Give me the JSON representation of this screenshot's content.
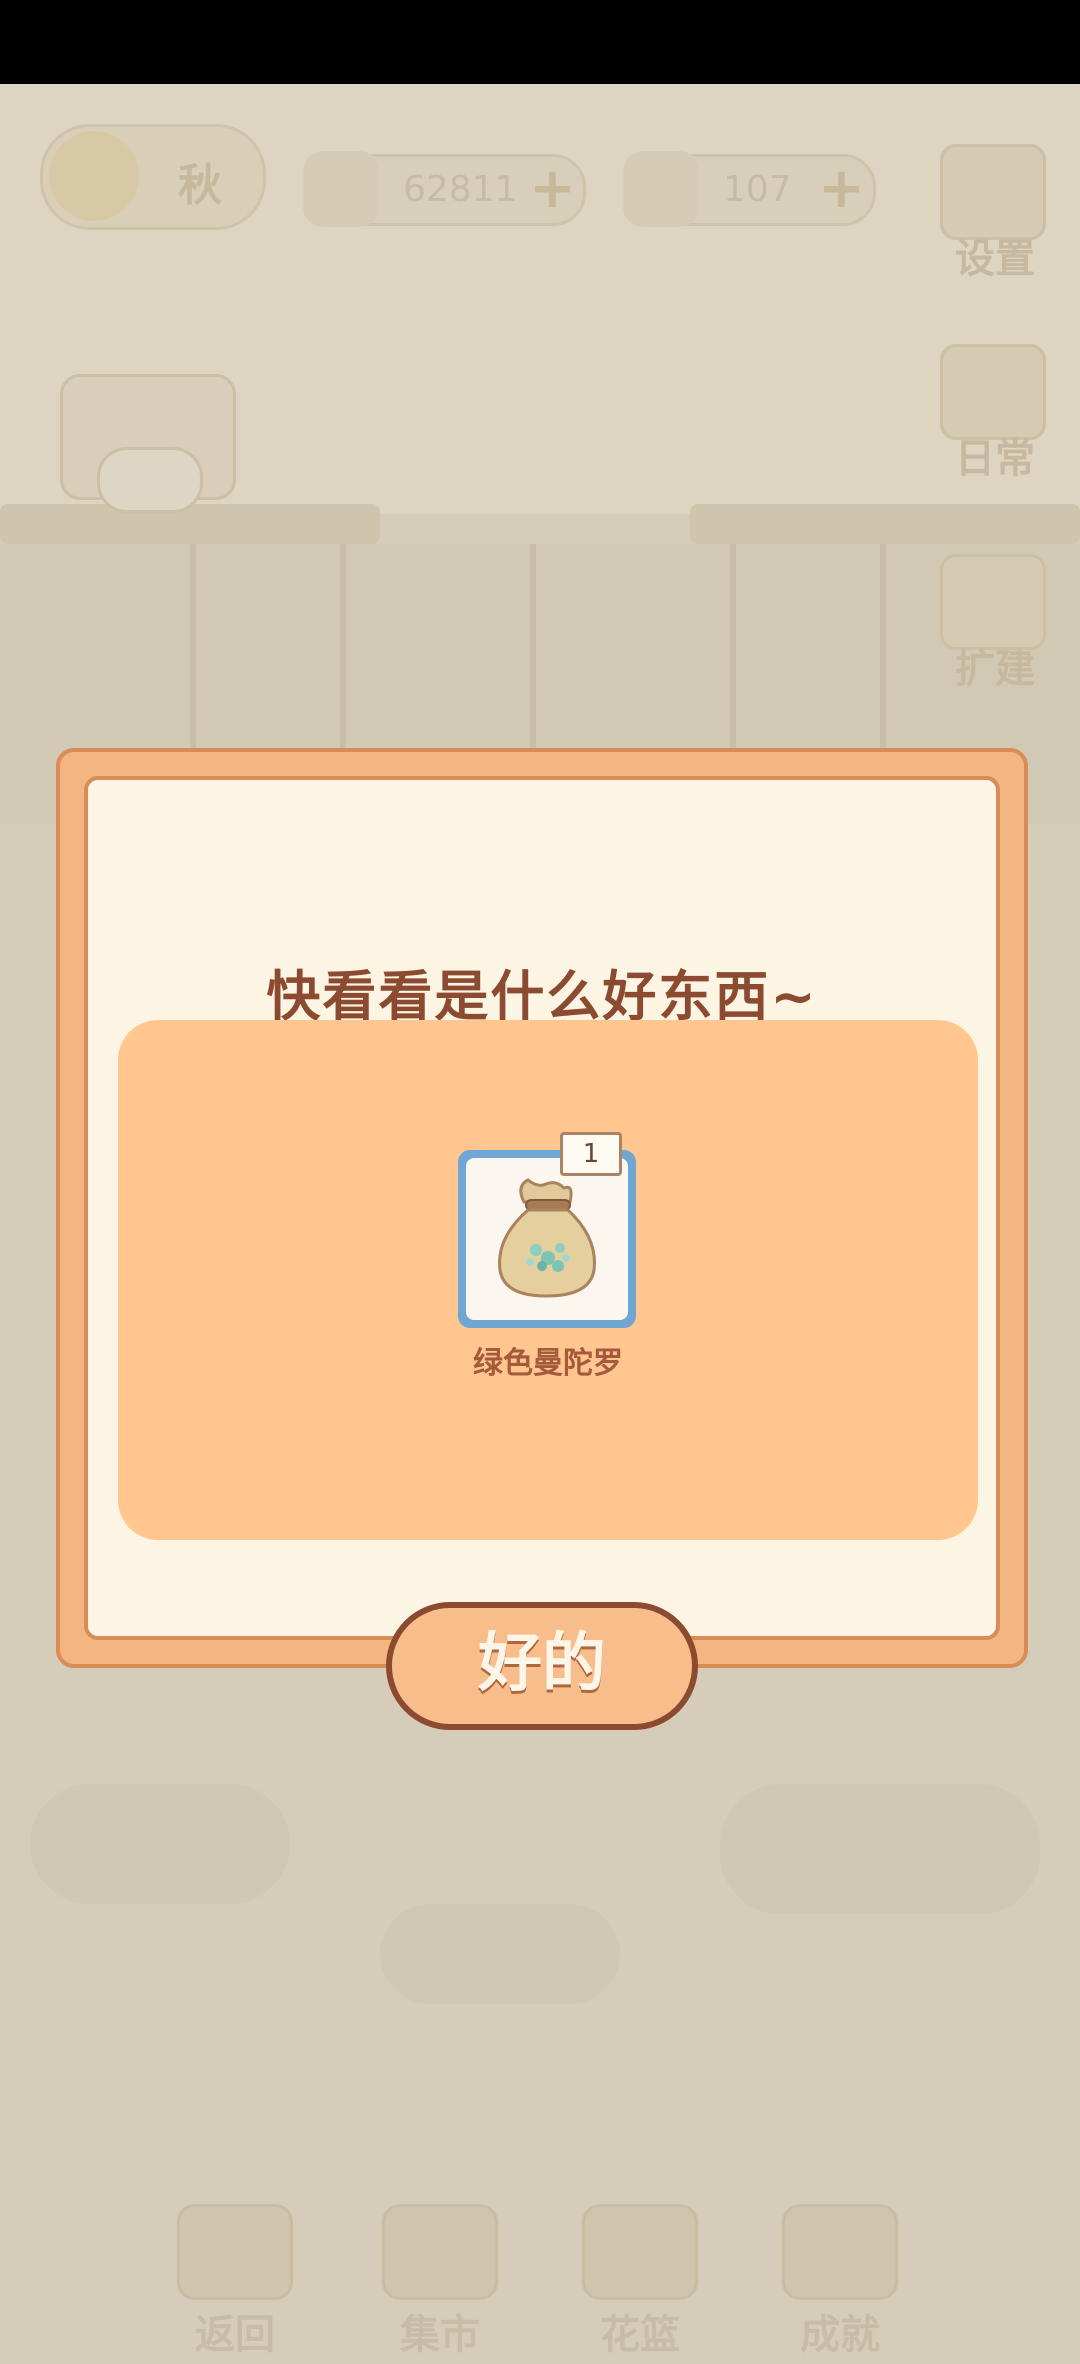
{
  "hud": {
    "season": "秋",
    "fish_currency": "62811",
    "cheese_currency": "107",
    "settings_label": "设置",
    "daily_label": "日常",
    "expand_label": "扩建"
  },
  "bottom_nav": {
    "items": [
      {
        "label": "返回"
      },
      {
        "label": "集市"
      },
      {
        "label": "花篮"
      },
      {
        "label": "成就"
      }
    ]
  },
  "dialog": {
    "title": "快看看是什么好东西~",
    "reward": {
      "name": "绿色曼陀罗",
      "quantity": "1"
    },
    "confirm_label": "好的"
  },
  "colors": {
    "dialog_frame": "#f3b581",
    "dialog_inner": "#fdf5e3",
    "reward_panel": "#ffc68f",
    "title_text": "#8c4a30",
    "item_border": "#6fa6d3"
  }
}
